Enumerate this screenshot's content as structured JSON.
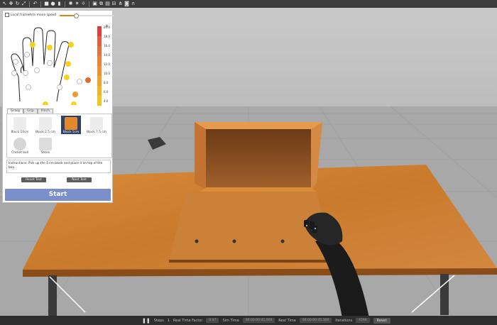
{
  "panel": {
    "local_frame_label": "Local frame",
    "arm_speed_label": "Arm move speed",
    "arm_speed_level": 0.3,
    "scale": {
      "unit": "N",
      "ticks": [
        "20.0",
        "18.0",
        "16.0",
        "14.0",
        "12.0",
        "10.0",
        "8.0",
        "6.0",
        "4.0"
      ]
    },
    "tabs": [
      "Grasp",
      "Grip",
      "Pinch"
    ],
    "objects": [
      {
        "label": "Block 10cm"
      },
      {
        "label": "Block 2.5 cm"
      },
      {
        "label": "Block 5cm"
      },
      {
        "label": "Block 7.5 cm"
      },
      {
        "label": "Cricket ball"
      },
      {
        "label": "Stone"
      }
    ],
    "selected_object": "Block 5cm",
    "instructions": "Instructions: Pick up the 5 cm block and place it on top of the box.",
    "reset_label": "Reset Test",
    "next_label": "Next Test",
    "start_label": "Start"
  },
  "bottombar": {
    "steps_label": "Steps",
    "steps_value": "1",
    "rtf_label": "Real Time Factor",
    "rtf_value": "0.97",
    "sim_label": "Sim Time",
    "sim_value": "00:00:00:45.069",
    "real_label": "Real Time",
    "real_value": "00:00:00:45.306",
    "iter_label": "Iterations",
    "iter_value": "4594",
    "reset_label": "Reset"
  },
  "colors": {
    "accent_orange": "#e57f1d",
    "start_button": "#7b8fcb",
    "selected_bg": "#2f3f67"
  }
}
